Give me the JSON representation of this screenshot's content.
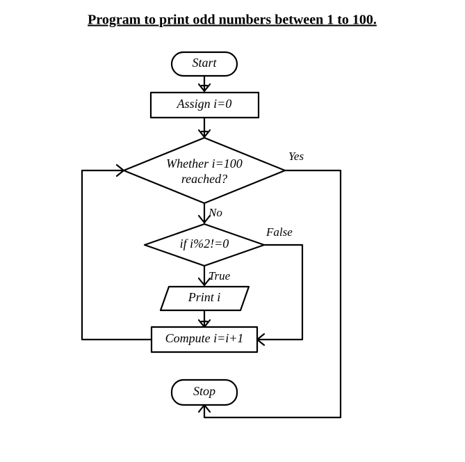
{
  "title": "Program to print odd numbers between 1 to 100.",
  "nodes": {
    "start": "Start",
    "assign": "Assign i=0",
    "check100_line1": "Whether i=100",
    "check100_line2": "reached?",
    "mod": "if i%2!=0",
    "print": "Print i",
    "inc": "Compute i=i+1",
    "stop": "Stop"
  },
  "edges": {
    "yes": "Yes",
    "no": "No",
    "true": "True",
    "false": "False"
  }
}
